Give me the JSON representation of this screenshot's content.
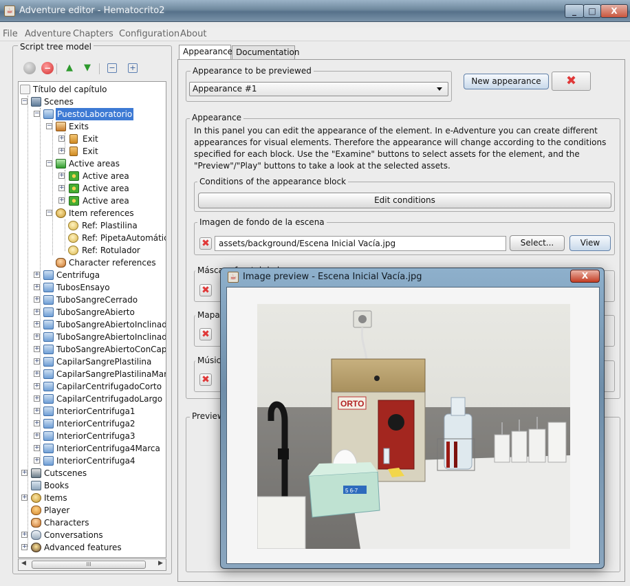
{
  "window": {
    "title": "Adventure editor - Hematocrito2"
  },
  "menu": [
    "File",
    "Adventure",
    "Chapters",
    "Configuration",
    "About"
  ],
  "tree_panel": {
    "legend": "Script tree model",
    "scrollbar_grip": "III"
  },
  "tree": {
    "chapter": "Título del capítulo",
    "scenes": "Scenes",
    "selected_scene": "PuestoLaboratorio",
    "exits": "Exits",
    "exit_items": [
      "Exit",
      "Exit"
    ],
    "active_areas": "Active areas",
    "active_area_items": [
      "Active area",
      "Active area",
      "Active area"
    ],
    "item_references": "Item references",
    "item_reference_items": [
      "Ref: Plastilina",
      "Ref: PipetaAutomátic",
      "Ref: Rotulador"
    ],
    "character_references": "Character references",
    "other_scenes": [
      "Centrifuga",
      "TubosEnsayo",
      "TuboSangreCerrado",
      "TuboSangreAbierto",
      "TuboSangreAbiertoInclinado",
      "TuboSangreAbiertoInclinado(",
      "TuboSangreAbiertoConCapila",
      "CapilarSangrePlastilina",
      "CapilarSangrePlastilinaMarca",
      "CapilarCentrifugadoCorto",
      "CapilarCentrifugadoLargo",
      "InteriorCentrifuga1",
      "InteriorCentrifuga2",
      "InteriorCentrifuga3",
      "InteriorCentrifuga4Marca",
      "InteriorCentrifuga4"
    ],
    "cutscenes": "Cutscenes",
    "books": "Books",
    "items": "Items",
    "player": "Player",
    "characters": "Characters",
    "conversations": "Conversations",
    "advanced": "Advanced features"
  },
  "tabs": {
    "appearance": "Appearance",
    "documentation": "Documentation"
  },
  "appearance_preview": {
    "legend": "Appearance to be previewed",
    "selected": "Appearance #1",
    "new_button": "New appearance"
  },
  "appearance": {
    "legend": "Appearance",
    "description": "In this panel you can edit the appearance of the element. In e-Adventure you can create different appearances for visual elements. Therefore the appearance will change according to the conditions specified for each block. Use the \"Examine\" buttons to select assets for the element, and the \"Preview\"/\"Play\" buttons to take a look at the selected assets.",
    "conditions_legend": "Conditions of the appearance block",
    "edit_conditions": "Edit conditions",
    "background_legend": "Imagen de fondo de la escena",
    "background_path": "assets/background/Escena Inicial Vacía.jpg",
    "select_button": "Select...",
    "view_button": "View",
    "mask_legend": "Máscara frontal de la",
    "map_legend": "Mapa",
    "music_legend": "Músic",
    "preview_legend": "Preview"
  },
  "dialog": {
    "title": "Image preview - Escena Inicial Vacía.jpg",
    "close": "X",
    "box_text": "5 6-7"
  },
  "colors": {
    "selection": "#3d7ad4",
    "delete_red": "#e03838",
    "titlebar": "#6e889d"
  }
}
